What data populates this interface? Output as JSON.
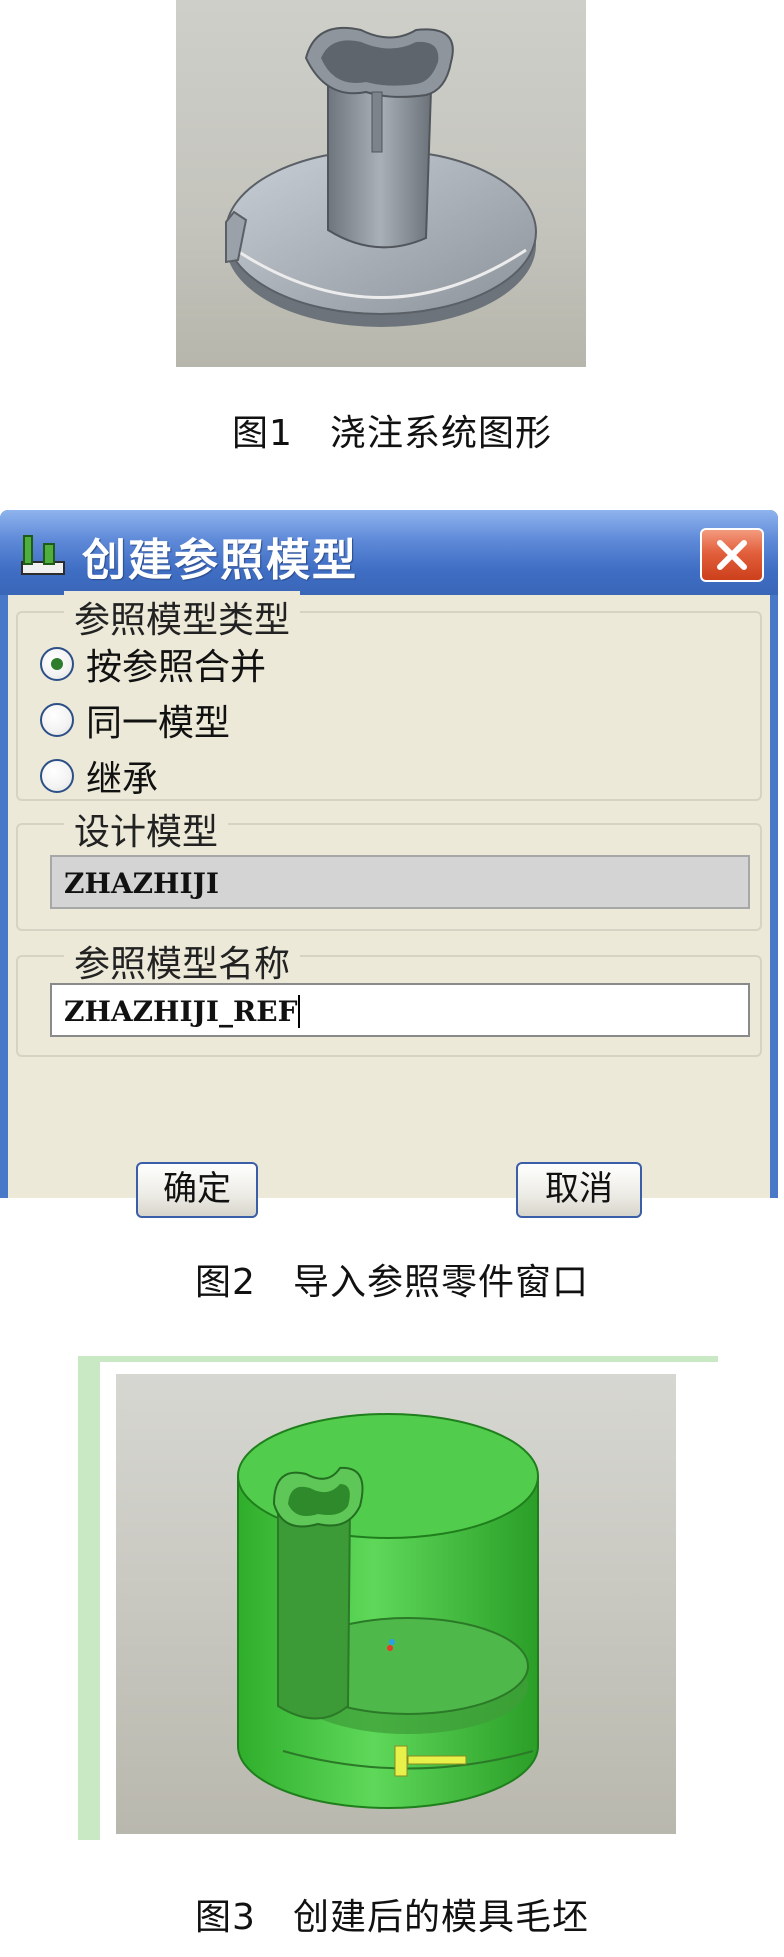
{
  "figure1": {
    "caption": "图1　浇注系统图形"
  },
  "figure2": {
    "caption": "图2　导入参照零件窗口",
    "dialog": {
      "title": "创建参照模型",
      "ref_model_type": {
        "legend": "参照模型类型",
        "options": [
          {
            "label": "按参照合并",
            "selected": true
          },
          {
            "label": "同一模型",
            "selected": false
          },
          {
            "label": "继承",
            "selected": false
          }
        ]
      },
      "design_model": {
        "legend": "设计模型",
        "value": "ZHAZHIJI"
      },
      "ref_model_name": {
        "legend": "参照模型名称",
        "value": "ZHAZHIJI_REF"
      },
      "ok_label": "确定",
      "cancel_label": "取消"
    }
  },
  "figure3": {
    "caption": "图3　创建后的模具毛坯"
  },
  "colors": {
    "titlebar": "#4a78c8",
    "dialog_bg": "#ece9d8",
    "close_button": "#d84a28",
    "mold_green": "#3ec43a"
  }
}
